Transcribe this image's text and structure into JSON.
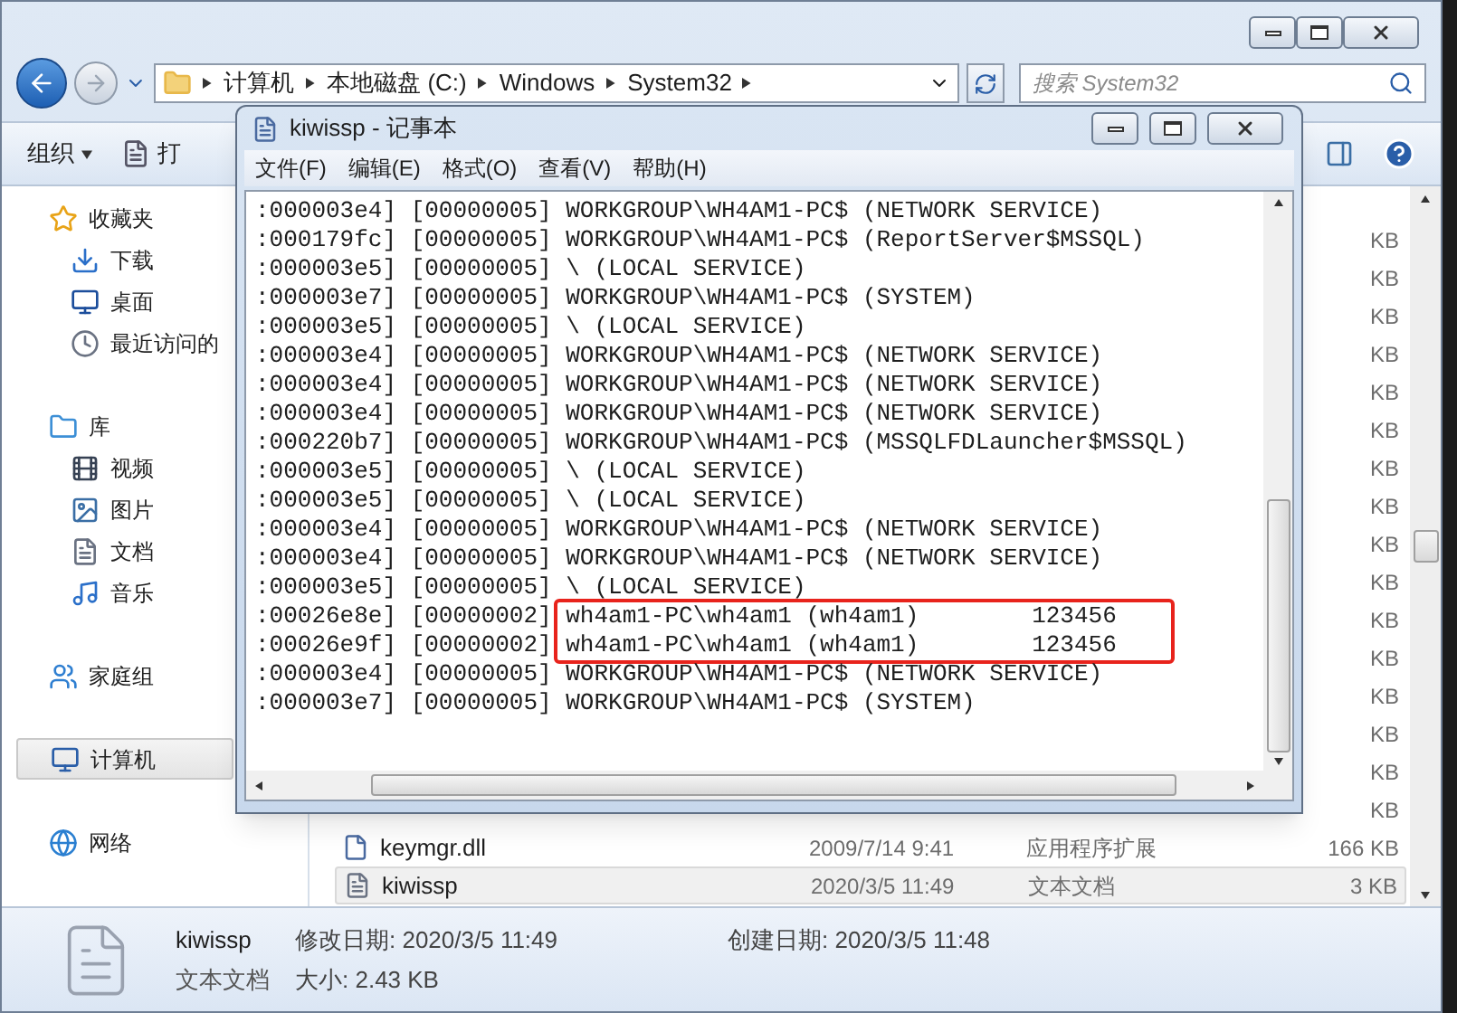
{
  "explorer": {
    "breadcrumb": [
      "计算机",
      "本地磁盘 (C:)",
      "Windows",
      "System32"
    ],
    "search": {
      "placeholder": "搜索 System32"
    },
    "toolbar": [
      {
        "label": "组织",
        "kind": "menu"
      },
      {
        "label": "打",
        "kind": "button"
      }
    ],
    "nav": [
      {
        "label": "收藏夹",
        "kind": "favorites",
        "selected": false
      },
      {
        "label": "下载",
        "kind": "download",
        "selected": false
      },
      {
        "label": "桌面",
        "kind": "desktop",
        "selected": false
      },
      {
        "label": "最近访问的",
        "kind": "recent",
        "selected": false
      },
      {
        "label": "库",
        "kind": "library",
        "selected": false
      },
      {
        "label": "视频",
        "kind": "video",
        "selected": false
      },
      {
        "label": "图片",
        "kind": "picture",
        "selected": false
      },
      {
        "label": "文档",
        "kind": "document",
        "selected": false
      },
      {
        "label": "音乐",
        "kind": "music",
        "selected": false
      },
      {
        "label": "家庭组",
        "kind": "homegroup",
        "selected": false
      },
      {
        "label": "计算机",
        "kind": "computer",
        "selected": true
      },
      {
        "label": "网络",
        "kind": "network",
        "selected": false
      }
    ],
    "files": [
      {
        "size": "KB",
        "selected": false
      },
      {
        "size": "KB",
        "selected": false
      },
      {
        "size": "KB",
        "selected": false
      },
      {
        "size": "KB",
        "selected": false
      },
      {
        "size": "KB",
        "selected": false
      },
      {
        "size": "KB",
        "selected": false
      },
      {
        "size": "KB",
        "selected": false
      },
      {
        "size": "KB",
        "selected": false
      },
      {
        "size": "KB",
        "selected": false
      },
      {
        "size": "KB",
        "selected": false
      },
      {
        "size": "KB",
        "selected": false
      },
      {
        "size": "KB",
        "selected": false
      },
      {
        "size": "KB",
        "selected": false
      },
      {
        "size": "KB",
        "selected": false
      },
      {
        "size": "KB",
        "selected": false
      },
      {
        "size": "KB",
        "selected": false
      },
      {
        "name": "keymgr.dll",
        "kind": "dll",
        "date": "2009/7/14 9:41",
        "type": "应用程序扩展",
        "size": "166 KB",
        "selected": false
      },
      {
        "name": "kiwissp",
        "kind": "text",
        "date": "2020/3/5 11:49",
        "type": "文本文档",
        "size": "3 KB",
        "selected": true
      }
    ],
    "details": {
      "name": "kiwissp",
      "modified": "修改日期: 2020/3/5 11:49",
      "created": "创建日期: 2020/3/5 11:48",
      "type": "文本文档",
      "size": "大小: 2.43 KB"
    }
  },
  "notepad": {
    "title": "kiwissp - 记事本",
    "menu": [
      "文件(F)",
      "编辑(E)",
      "格式(O)",
      "查看(V)",
      "帮助(H)"
    ],
    "lines": [
      {
        "luid": ":000003e4]",
        "session": "[00000005]",
        "account": "WORKGROUP\\WH4AM1-PC$ (NETWORK SERVICE)",
        "highlighted": false
      },
      {
        "luid": ":000179fc]",
        "session": "[00000005]",
        "account": "WORKGROUP\\WH4AM1-PC$ (ReportServer$MSSQL)",
        "highlighted": false
      },
      {
        "luid": ":000003e5]",
        "session": "[00000005]",
        "account": "\\ (LOCAL SERVICE)",
        "highlighted": false
      },
      {
        "luid": ":000003e7]",
        "session": "[00000005]",
        "account": "WORKGROUP\\WH4AM1-PC$ (SYSTEM)",
        "highlighted": false
      },
      {
        "luid": ":000003e5]",
        "session": "[00000005]",
        "account": "\\ (LOCAL SERVICE)",
        "highlighted": false
      },
      {
        "luid": ":000003e4]",
        "session": "[00000005]",
        "account": "WORKGROUP\\WH4AM1-PC$ (NETWORK SERVICE)",
        "highlighted": false
      },
      {
        "luid": ":000003e4]",
        "session": "[00000005]",
        "account": "WORKGROUP\\WH4AM1-PC$ (NETWORK SERVICE)",
        "highlighted": false
      },
      {
        "luid": ":000003e4]",
        "session": "[00000005]",
        "account": "WORKGROUP\\WH4AM1-PC$ (NETWORK SERVICE)",
        "highlighted": false
      },
      {
        "luid": ":000220b7]",
        "session": "[00000005]",
        "account": "WORKGROUP\\WH4AM1-PC$ (MSSQLFDLauncher$MSSQL)",
        "highlighted": false
      },
      {
        "luid": ":000003e5]",
        "session": "[00000005]",
        "account": "\\ (LOCAL SERVICE)",
        "highlighted": false
      },
      {
        "luid": ":000003e5]",
        "session": "[00000005]",
        "account": "\\ (LOCAL SERVICE)",
        "highlighted": false
      },
      {
        "luid": ":000003e4]",
        "session": "[00000005]",
        "account": "WORKGROUP\\WH4AM1-PC$ (NETWORK SERVICE)",
        "highlighted": false
      },
      {
        "luid": ":000003e4]",
        "session": "[00000005]",
        "account": "WORKGROUP\\WH4AM1-PC$ (NETWORK SERVICE)",
        "highlighted": false
      },
      {
        "luid": ":000003e5]",
        "session": "[00000005]",
        "account": "\\ (LOCAL SERVICE)",
        "highlighted": false
      },
      {
        "luid": ":00026e8e]",
        "session": "[00000002]",
        "account": "wh4am1-PC\\wh4am1 (wh4am1)        123456",
        "highlighted": true
      },
      {
        "luid": ":00026e9f]",
        "session": "[00000002]",
        "account": "wh4am1-PC\\wh4am1 (wh4am1)        123456",
        "highlighted": true
      },
      {
        "luid": ":000003e4]",
        "session": "[00000005]",
        "account": "WORKGROUP\\WH4AM1-PC$ (NETWORK SERVICE)",
        "highlighted": false
      },
      {
        "luid": ":000003e7]",
        "session": "[00000005]",
        "account": "WORKGROUP\\WH4AM1-PC$ (SYSTEM)",
        "highlighted": false
      }
    ]
  }
}
